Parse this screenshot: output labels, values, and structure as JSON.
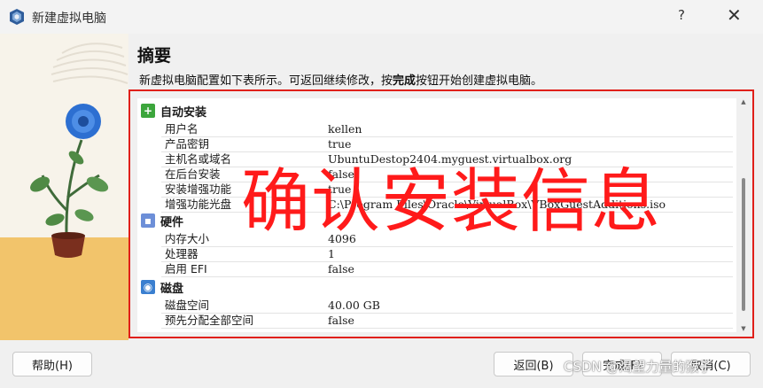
{
  "window": {
    "title": "新建虚拟电脑",
    "help_glyph": "?",
    "close_glyph": "✕"
  },
  "summary": {
    "heading": "摘要",
    "description_before": "新虚拟电脑配置如下表所示。可返回继续修改，按",
    "description_bold": "完成",
    "description_after": "按钮开始创建虚拟电脑。"
  },
  "sections": {
    "unattended": {
      "title": "自动安装",
      "icon": "green-plus-icon",
      "rows": [
        {
          "key": "用户名",
          "value": "kellen"
        },
        {
          "key": "产品密钥",
          "value": "true"
        },
        {
          "key": "主机名或域名",
          "value": "UbuntuDestop2404.myguest.virtualbox.org"
        },
        {
          "key": "在后台安装",
          "value": "false"
        },
        {
          "key": "安装增强功能",
          "value": "true"
        },
        {
          "key": "增强功能光盘",
          "value": "C:\\Program Files\\Oracle\\VirtualBox\\VBoxGuestAdditions.iso"
        }
      ]
    },
    "hardware": {
      "title": "硬件",
      "icon": "chip-icon",
      "rows": [
        {
          "key": "内存大小",
          "value": "4096"
        },
        {
          "key": "处理器",
          "value": "1"
        },
        {
          "key": "启用 EFI",
          "value": "false"
        }
      ]
    },
    "disk": {
      "title": "磁盘",
      "icon": "disk-icon",
      "rows": [
        {
          "key": "磁盘空间",
          "value": "40.00 GB"
        },
        {
          "key": "预先分配全部空间",
          "value": "false"
        }
      ]
    }
  },
  "overlay_text": "确认安装信息",
  "buttons": {
    "help": "帮助(H)",
    "back": "返回(B)",
    "finish": "完成(F)",
    "cancel": "取消(C)"
  },
  "watermark": "CSDN @渴望力量的猴子",
  "colors": {
    "highlight_border": "#e0201a",
    "overlay_text": "#ff1a1a"
  }
}
